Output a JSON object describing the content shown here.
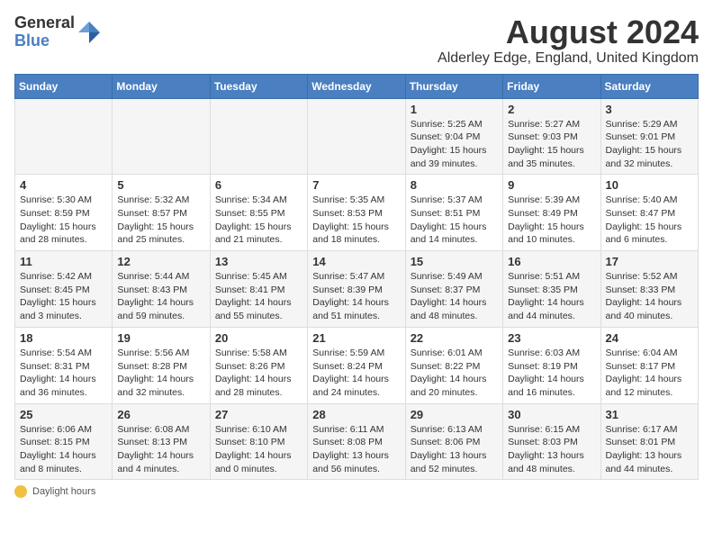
{
  "header": {
    "logo_line1": "General",
    "logo_line2": "Blue",
    "title": "August 2024",
    "subtitle": "Alderley Edge, England, United Kingdom"
  },
  "days_of_week": [
    "Sunday",
    "Monday",
    "Tuesday",
    "Wednesday",
    "Thursday",
    "Friday",
    "Saturday"
  ],
  "weeks": [
    [
      {
        "day": "",
        "info": ""
      },
      {
        "day": "",
        "info": ""
      },
      {
        "day": "",
        "info": ""
      },
      {
        "day": "",
        "info": ""
      },
      {
        "day": "1",
        "info": "Sunrise: 5:25 AM\nSunset: 9:04 PM\nDaylight: 15 hours\nand 39 minutes."
      },
      {
        "day": "2",
        "info": "Sunrise: 5:27 AM\nSunset: 9:03 PM\nDaylight: 15 hours\nand 35 minutes."
      },
      {
        "day": "3",
        "info": "Sunrise: 5:29 AM\nSunset: 9:01 PM\nDaylight: 15 hours\nand 32 minutes."
      }
    ],
    [
      {
        "day": "4",
        "info": "Sunrise: 5:30 AM\nSunset: 8:59 PM\nDaylight: 15 hours\nand 28 minutes."
      },
      {
        "day": "5",
        "info": "Sunrise: 5:32 AM\nSunset: 8:57 PM\nDaylight: 15 hours\nand 25 minutes."
      },
      {
        "day": "6",
        "info": "Sunrise: 5:34 AM\nSunset: 8:55 PM\nDaylight: 15 hours\nand 21 minutes."
      },
      {
        "day": "7",
        "info": "Sunrise: 5:35 AM\nSunset: 8:53 PM\nDaylight: 15 hours\nand 18 minutes."
      },
      {
        "day": "8",
        "info": "Sunrise: 5:37 AM\nSunset: 8:51 PM\nDaylight: 15 hours\nand 14 minutes."
      },
      {
        "day": "9",
        "info": "Sunrise: 5:39 AM\nSunset: 8:49 PM\nDaylight: 15 hours\nand 10 minutes."
      },
      {
        "day": "10",
        "info": "Sunrise: 5:40 AM\nSunset: 8:47 PM\nDaylight: 15 hours\nand 6 minutes."
      }
    ],
    [
      {
        "day": "11",
        "info": "Sunrise: 5:42 AM\nSunset: 8:45 PM\nDaylight: 15 hours\nand 3 minutes."
      },
      {
        "day": "12",
        "info": "Sunrise: 5:44 AM\nSunset: 8:43 PM\nDaylight: 14 hours\nand 59 minutes."
      },
      {
        "day": "13",
        "info": "Sunrise: 5:45 AM\nSunset: 8:41 PM\nDaylight: 14 hours\nand 55 minutes."
      },
      {
        "day": "14",
        "info": "Sunrise: 5:47 AM\nSunset: 8:39 PM\nDaylight: 14 hours\nand 51 minutes."
      },
      {
        "day": "15",
        "info": "Sunrise: 5:49 AM\nSunset: 8:37 PM\nDaylight: 14 hours\nand 48 minutes."
      },
      {
        "day": "16",
        "info": "Sunrise: 5:51 AM\nSunset: 8:35 PM\nDaylight: 14 hours\nand 44 minutes."
      },
      {
        "day": "17",
        "info": "Sunrise: 5:52 AM\nSunset: 8:33 PM\nDaylight: 14 hours\nand 40 minutes."
      }
    ],
    [
      {
        "day": "18",
        "info": "Sunrise: 5:54 AM\nSunset: 8:31 PM\nDaylight: 14 hours\nand 36 minutes."
      },
      {
        "day": "19",
        "info": "Sunrise: 5:56 AM\nSunset: 8:28 PM\nDaylight: 14 hours\nand 32 minutes."
      },
      {
        "day": "20",
        "info": "Sunrise: 5:58 AM\nSunset: 8:26 PM\nDaylight: 14 hours\nand 28 minutes."
      },
      {
        "day": "21",
        "info": "Sunrise: 5:59 AM\nSunset: 8:24 PM\nDaylight: 14 hours\nand 24 minutes."
      },
      {
        "day": "22",
        "info": "Sunrise: 6:01 AM\nSunset: 8:22 PM\nDaylight: 14 hours\nand 20 minutes."
      },
      {
        "day": "23",
        "info": "Sunrise: 6:03 AM\nSunset: 8:19 PM\nDaylight: 14 hours\nand 16 minutes."
      },
      {
        "day": "24",
        "info": "Sunrise: 6:04 AM\nSunset: 8:17 PM\nDaylight: 14 hours\nand 12 minutes."
      }
    ],
    [
      {
        "day": "25",
        "info": "Sunrise: 6:06 AM\nSunset: 8:15 PM\nDaylight: 14 hours\nand 8 minutes."
      },
      {
        "day": "26",
        "info": "Sunrise: 6:08 AM\nSunset: 8:13 PM\nDaylight: 14 hours\nand 4 minutes."
      },
      {
        "day": "27",
        "info": "Sunrise: 6:10 AM\nSunset: 8:10 PM\nDaylight: 14 hours\nand 0 minutes."
      },
      {
        "day": "28",
        "info": "Sunrise: 6:11 AM\nSunset: 8:08 PM\nDaylight: 13 hours\nand 56 minutes."
      },
      {
        "day": "29",
        "info": "Sunrise: 6:13 AM\nSunset: 8:06 PM\nDaylight: 13 hours\nand 52 minutes."
      },
      {
        "day": "30",
        "info": "Sunrise: 6:15 AM\nSunset: 8:03 PM\nDaylight: 13 hours\nand 48 minutes."
      },
      {
        "day": "31",
        "info": "Sunrise: 6:17 AM\nSunset: 8:01 PM\nDaylight: 13 hours\nand 44 minutes."
      }
    ]
  ],
  "footnote": "Daylight hours"
}
